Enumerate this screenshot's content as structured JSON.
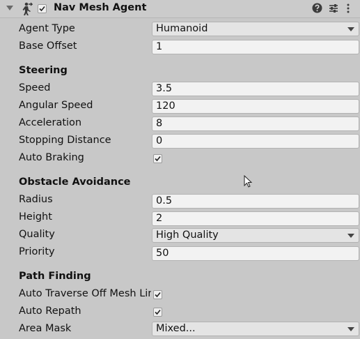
{
  "component": {
    "title": "Nav Mesh Agent",
    "enabled": true,
    "icons": [
      "nav-mesh-agent-icon",
      "help-icon",
      "presets-icon",
      "menu-icon"
    ]
  },
  "agent_type": {
    "label": "Agent Type",
    "value": "Humanoid"
  },
  "base_offset": {
    "label": "Base Offset",
    "value": "1"
  },
  "steering": {
    "heading": "Steering",
    "speed": {
      "label": "Speed",
      "value": "3.5"
    },
    "angular_speed": {
      "label": "Angular Speed",
      "value": "120"
    },
    "acceleration": {
      "label": "Acceleration",
      "value": "8"
    },
    "stopping_distance": {
      "label": "Stopping Distance",
      "value": "0"
    },
    "auto_braking": {
      "label": "Auto Braking",
      "checked": true
    }
  },
  "obstacle_avoidance": {
    "heading": "Obstacle Avoidance",
    "radius": {
      "label": "Radius",
      "value": "0.5"
    },
    "height": {
      "label": "Height",
      "value": "2"
    },
    "quality": {
      "label": "Quality",
      "value": "High Quality"
    },
    "priority": {
      "label": "Priority",
      "value": "50"
    }
  },
  "path_finding": {
    "heading": "Path Finding",
    "auto_traverse": {
      "label": "Auto Traverse Off Mesh Link",
      "checked": true
    },
    "auto_repath": {
      "label": "Auto Repath",
      "checked": true
    },
    "area_mask": {
      "label": "Area Mask",
      "value": "Mixed..."
    }
  }
}
